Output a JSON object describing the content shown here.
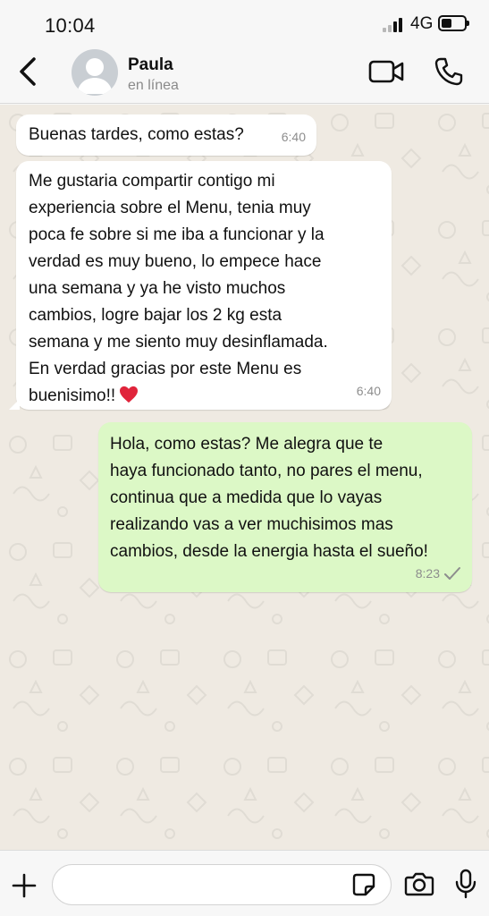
{
  "status_bar": {
    "time": "10:04",
    "network": "4G",
    "signal_icon": "signal-bars-icon",
    "battery_icon": "battery-icon"
  },
  "header": {
    "back_icon": "chevron-left-icon",
    "contact_name": "Paula",
    "contact_status": "en línea",
    "video_icon": "video-camera-icon",
    "call_icon": "phone-icon"
  },
  "messages": [
    {
      "direction": "incoming",
      "text": "Buenas tardes, como estas?",
      "time": "6:40"
    },
    {
      "direction": "incoming",
      "text": "Me gustaria compartir contigo mi\nexperiencia sobre el Menu, tenia muy\npoca fe sobre si me iba a funcionar y la\nverdad es muy bueno, lo empece hace\nuna semana y ya he visto muchos\ncambios, logre bajar los 2 kg esta\nsemana y me siento muy desinflamada.\nEn verdad gracias por este Menu es\nbuenisimo!!",
      "emoji_icon": "red-heart-icon",
      "time": "6:40"
    },
    {
      "direction": "outgoing",
      "text": "Hola, como estas? Me alegra que te\nhaya funcionado tanto, no pares el menu,\ncontinua que a medida que lo vayas\nrealizando vas a ver muchisimos mas\ncambios, desde la energia hasta el sueño!",
      "time": "8:23",
      "status_icon": "single-check-icon"
    }
  ],
  "input_bar": {
    "plus_icon": "plus-icon",
    "message_value": "",
    "sticker_icon": "sticker-icon",
    "camera_icon": "camera-icon",
    "mic_icon": "microphone-icon"
  },
  "colors": {
    "chat_background": "#efeae2",
    "incoming_bubble": "#ffffff",
    "outgoing_bubble": "#dcf8c6",
    "heart": "#e0243b"
  }
}
